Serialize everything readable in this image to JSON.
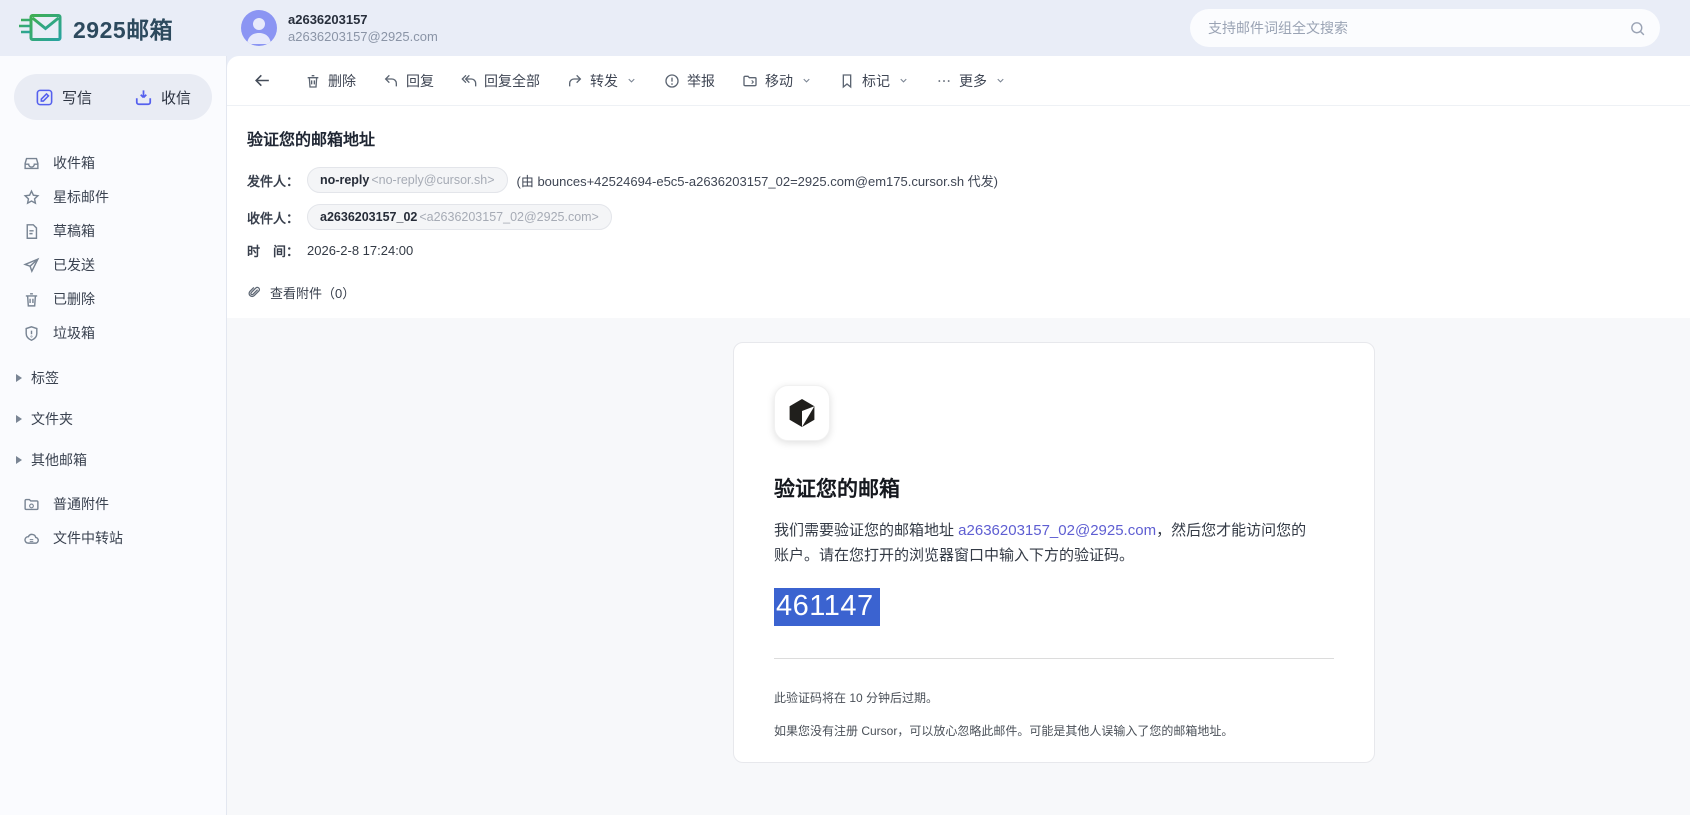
{
  "header": {
    "logo_text": "2925邮箱",
    "account": {
      "name": "a2636203157",
      "email": "a2636203157@2925.com"
    },
    "search": {
      "placeholder": "支持邮件词组全文搜索"
    }
  },
  "sidebar": {
    "compose": "写信",
    "receive": "收信",
    "items": [
      {
        "label": "收件箱"
      },
      {
        "label": "星标邮件"
      },
      {
        "label": "草稿箱"
      },
      {
        "label": "已发送"
      },
      {
        "label": "已删除"
      },
      {
        "label": "垃圾箱"
      }
    ],
    "groups": [
      {
        "label": "标签"
      },
      {
        "label": "文件夹"
      },
      {
        "label": "其他邮箱"
      }
    ],
    "extras": [
      {
        "label": "普通附件"
      },
      {
        "label": "文件中转站"
      }
    ]
  },
  "toolbar": {
    "delete": "删除",
    "reply": "回复",
    "reply_all": "回复全部",
    "forward": "转发",
    "report": "举报",
    "move": "移动",
    "mark": "标记",
    "more": "更多"
  },
  "mail": {
    "subject": "验证您的邮箱地址",
    "from_label": "发件人：",
    "from_name": "no-reply",
    "from_address": "<no-reply@cursor.sh>",
    "from_via": "(由 bounces+42524694-e5c5-a2636203157_02=2925.com@em175.cursor.sh 代发)",
    "to_label": "收件人：",
    "to_name": "a2636203157_02",
    "to_address": "<a2636203157_02@2925.com>",
    "time_label": "时　间：",
    "time_value": "2026-2-8 17:24:00",
    "attachments_label": "查看附件（0）"
  },
  "body": {
    "title": "验证您的邮箱",
    "para_before_link": "我们需要验证您的邮箱地址 ",
    "link": "a2636203157_02@2925.com",
    "para_after_link": "，然后您才能访问您的账户。请在您打开的浏览器窗口中输入下方的验证码。",
    "code": "461147",
    "note1": "此验证码将在 10 分钟后过期。",
    "note2": "如果您没有注册 Cursor，可以放心忽略此邮件。可能是其他人误输入了您的邮箱地址。"
  },
  "colors": {
    "accent_blue": "#5560ee",
    "selection_blue": "#3b63d0",
    "link_purple": "#5e5ed2",
    "logo_green": "#3fae52",
    "logo_teal": "#28a3a0",
    "header_bg": "#e9edf7",
    "body_bg": "#f7f8fa"
  }
}
